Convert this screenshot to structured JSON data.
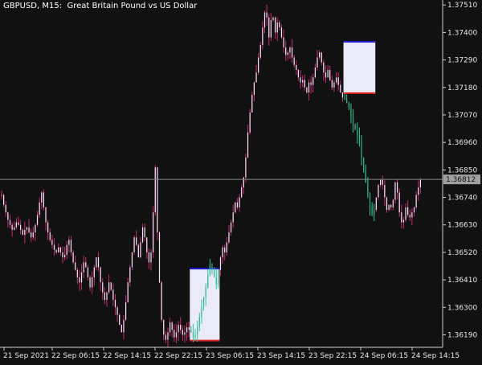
{
  "header": {
    "symbol_title": "GBPUSD, M15:  Great Britain Pound vs US Dollar"
  },
  "chart_data": {
    "type": "candlestick",
    "symbol": "GBPUSD",
    "timeframe": "M15",
    "title": "GBPUSD, M15:  Great Britain Pound vs US Dollar",
    "y_ticks": [
      "1.37510",
      "1.37400",
      "1.37290",
      "1.37180",
      "1.37070",
      "1.36960",
      "1.36850",
      "1.36740",
      "1.36630",
      "1.36520",
      "1.36410",
      "1.36300",
      "1.36190"
    ],
    "ylim": [
      1.3614,
      1.3753
    ],
    "current_price": "1.36812",
    "x_ticks": [
      "21 Sep 2021",
      "22 Sep 06:15",
      "22 Sep 14:15",
      "22 Sep 22:15",
      "23 Sep 06:15",
      "23 Sep 14:15",
      "23 Sep 22:15",
      "24 Sep 06:15",
      "24 Sep 14:15"
    ],
    "candle_count": 210,
    "colors": {
      "background": "#111111",
      "candle_body": "#ffe0ff",
      "candle_wick": "#c0306a",
      "grid_line": "#888888",
      "box_fill": "#eaeaf8",
      "box_top_line": "#1a1acc",
      "box_bottom_line": "#e02020",
      "axis_text": "#e6e6e6"
    },
    "close_series": [
      1.3675,
      1.3671,
      1.3668,
      1.3665,
      1.3663,
      1.3661,
      1.3662,
      1.3664,
      1.3663,
      1.3661,
      1.3659,
      1.3661,
      1.3662,
      1.366,
      1.3658,
      1.366,
      1.3663,
      1.3667,
      1.3672,
      1.3676,
      1.367,
      1.3664,
      1.366,
      1.3657,
      1.3655,
      1.3653,
      1.3652,
      1.3654,
      1.3652,
      1.365,
      1.3651,
      1.3655,
      1.3657,
      1.3652,
      1.3648,
      1.3645,
      1.3642,
      1.364,
      1.3644,
      1.3648,
      1.3646,
      1.3642,
      1.3638,
      1.3642,
      1.3646,
      1.365,
      1.3646,
      1.364,
      1.3636,
      1.3633,
      1.3636,
      1.364,
      1.3637,
      1.3633,
      1.363,
      1.3627,
      1.3623,
      1.362,
      1.3625,
      1.3632,
      1.364,
      1.3646,
      1.3652,
      1.3658,
      1.3655,
      1.365,
      1.3656,
      1.3662,
      1.3658,
      1.3652,
      1.3648,
      1.3652,
      1.3668,
      1.3686,
      1.366,
      1.364,
      1.3625,
      1.3619,
      1.3617,
      1.362,
      1.3624,
      1.3621,
      1.3618,
      1.362,
      1.3623,
      1.3621,
      1.3619,
      1.362,
      1.3622,
      1.3621,
      1.362,
      1.3618,
      1.3619,
      1.3622,
      1.3626,
      1.363,
      1.3634,
      1.3638,
      1.3643,
      1.3647,
      1.3645,
      1.3642,
      1.3639,
      1.3645,
      1.365,
      1.3654,
      1.3652,
      1.3656,
      1.366,
      1.3664,
      1.3668,
      1.3672,
      1.367,
      1.3674,
      1.3678,
      1.3682,
      1.369,
      1.37,
      1.3708,
      1.3715,
      1.372,
      1.3724,
      1.373,
      1.3735,
      1.3742,
      1.3748,
      1.3746,
      1.3738,
      1.3745,
      1.3746,
      1.374,
      1.3744,
      1.3742,
      1.3738,
      1.3734,
      1.3731,
      1.3732,
      1.3734,
      1.373,
      1.3727,
      1.3725,
      1.3722,
      1.372,
      1.3721,
      1.3718,
      1.3716,
      1.372,
      1.3719,
      1.3722,
      1.3726,
      1.373,
      1.3732,
      1.3728,
      1.3724,
      1.3722,
      1.3725,
      1.3721,
      1.3718,
      1.372,
      1.3722,
      1.3719,
      1.3716,
      1.3714,
      1.3713,
      1.3712,
      1.371,
      1.3706,
      1.3703,
      1.3701,
      1.3699,
      1.3697,
      1.369,
      1.3685,
      1.368,
      1.3675,
      1.367,
      1.3667,
      1.3669,
      1.3674,
      1.3679,
      1.3681,
      1.3679,
      1.3674,
      1.3669,
      1.3671,
      1.367,
      1.3673,
      1.368,
      1.3676,
      1.3668,
      1.3664,
      1.3665,
      1.367,
      1.3667,
      1.3666,
      1.3668,
      1.367,
      1.3675,
      1.3678,
      1.3681
    ],
    "range_boxes": [
      {
        "name": "box-1",
        "start_index": 90,
        "end_index": 103,
        "high": 1.36455,
        "low": 1.36167
      },
      {
        "name": "box-2",
        "start_index": 163,
        "end_index": 177,
        "high": 1.37363,
        "low": 1.37157
      }
    ]
  }
}
